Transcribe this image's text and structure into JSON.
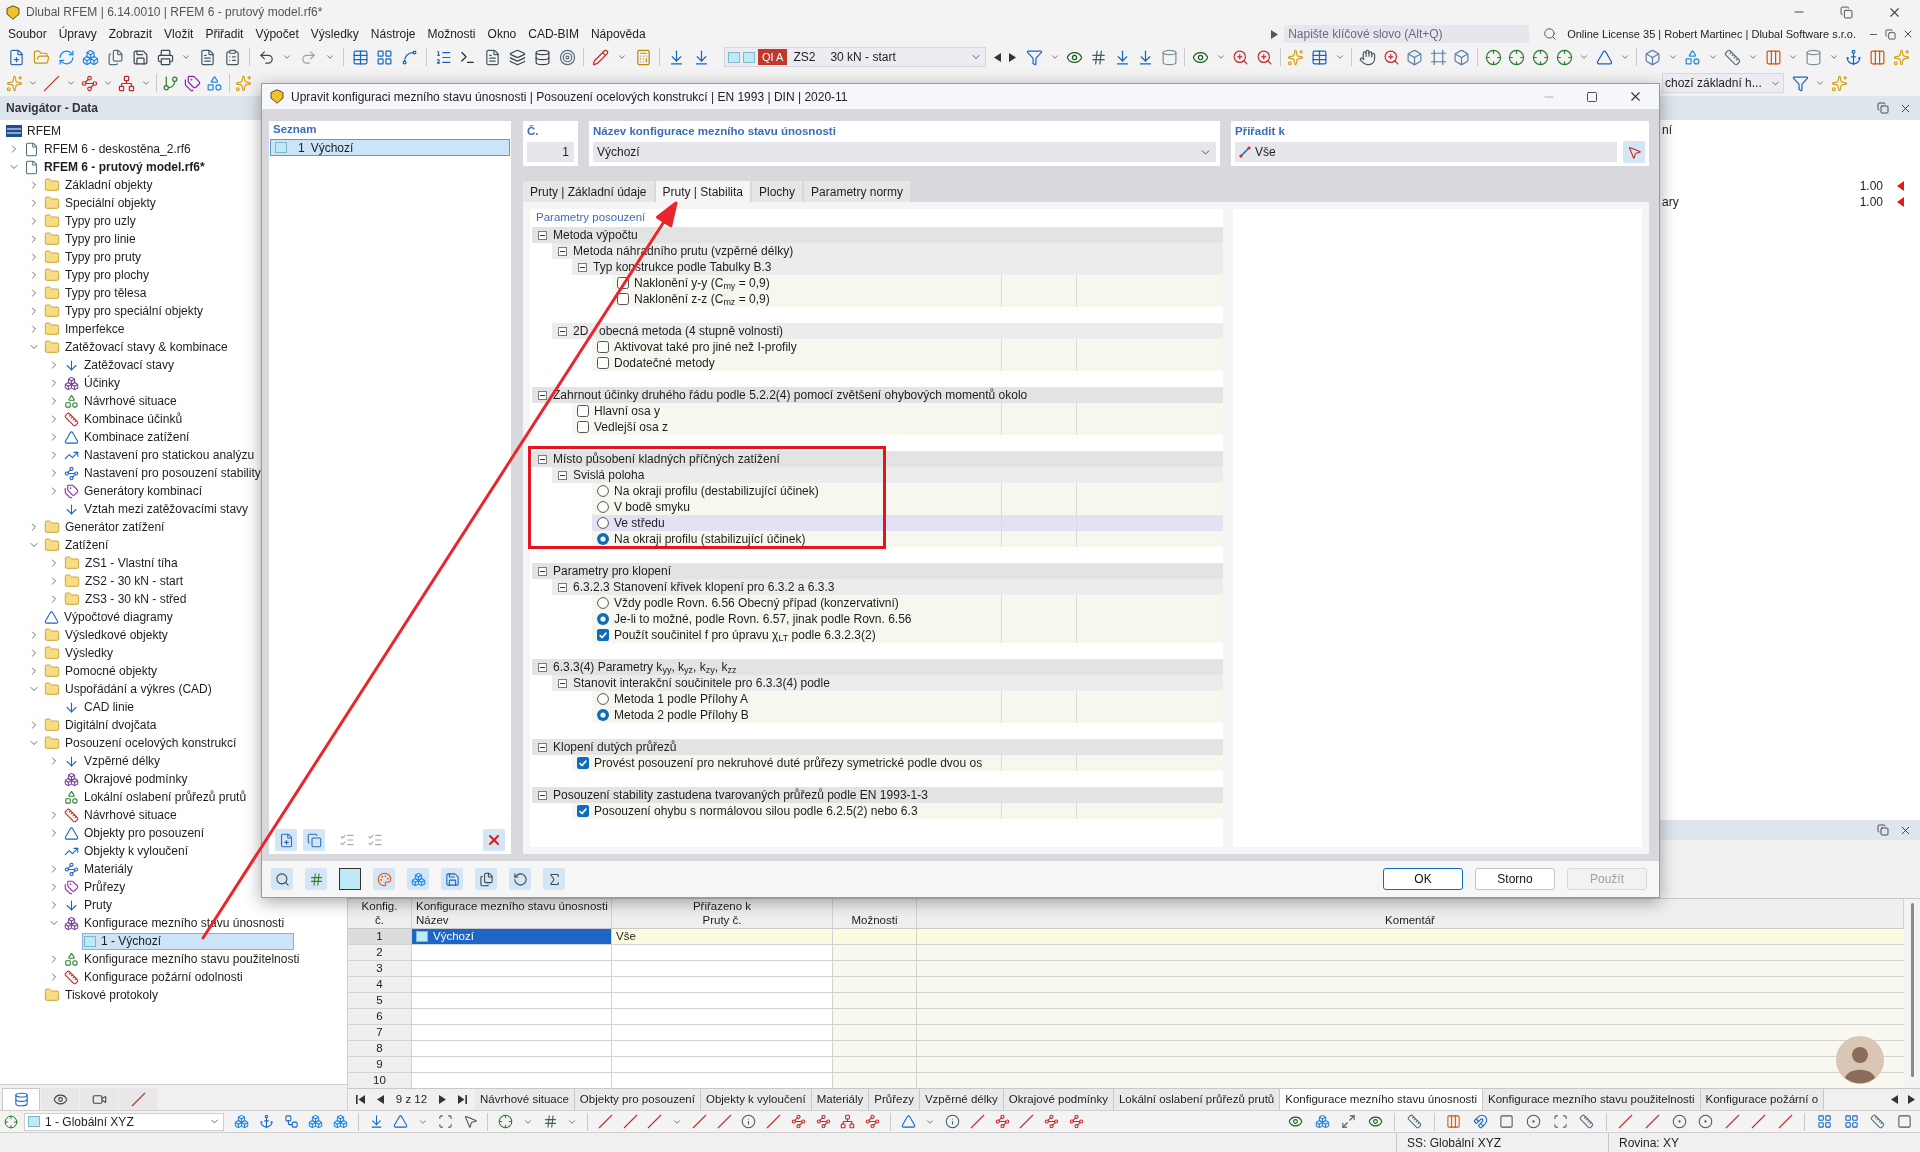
{
  "window": {
    "title": "Dlubal RFEM | 6.14.0010 | RFEM 6 - prutový model.rf6*"
  },
  "menu": [
    "Soubor",
    "Úpravy",
    "Zobrazit",
    "Vložit",
    "Přiřadit",
    "Výpočet",
    "Výsledky",
    "Nástroje",
    "Možnosti",
    "Okno",
    "CAD-BIM",
    "Nápověda"
  ],
  "search": {
    "placeholder": "Napište klíčové slovo (Alt+Q)"
  },
  "license": "Online License 35 | Robert Martinec | Dlubal Software s.r.o.",
  "toolbar": {
    "load_type": "QI A",
    "load_case": "ZS2",
    "load_case_name": "30 kN - start",
    "view_preset": "chozí základní h..."
  },
  "navigator": {
    "title": "Navigátor - Data",
    "tree": [
      {
        "label": "RFEM",
        "kind": "root",
        "selected": false,
        "children": [
          {
            "label": "RFEM 6 - deskostěna_2.rf6",
            "kind": "file",
            "active": false,
            "expanded": false,
            "selected": false
          },
          {
            "label": "RFEM 6 - prutový model.rf6*",
            "kind": "file",
            "active": true,
            "expanded": true,
            "selected": false,
            "children": [
              {
                "label": "Základní objekty",
                "kind": "folder",
                "expanded": false,
                "selected": false
              },
              {
                "label": "Speciální objekty",
                "kind": "folder",
                "expanded": false,
                "selected": false
              },
              {
                "label": "Typy pro uzly",
                "kind": "folder",
                "expanded": false,
                "selected": false
              },
              {
                "label": "Typy pro linie",
                "kind": "folder",
                "expanded": false,
                "selected": false
              },
              {
                "label": "Typy pro pruty",
                "kind": "folder",
                "expanded": false,
                "selected": false
              },
              {
                "label": "Typy pro plochy",
                "kind": "folder",
                "expanded": false,
                "selected": false
              },
              {
                "label": "Typy pro tělesa",
                "kind": "folder",
                "expanded": false,
                "selected": false
              },
              {
                "label": "Typy pro speciální objekty",
                "kind": "folder",
                "expanded": false,
                "selected": false
              },
              {
                "label": "Imperfekce",
                "kind": "folder",
                "expanded": false,
                "selected": false
              },
              {
                "label": "Zatěžovací stavy & kombinace",
                "kind": "folder",
                "expanded": true,
                "selected": false,
                "children": [
                  {
                    "label": "Zatěžovací stavy",
                    "kind": "object",
                    "expanded": false,
                    "selected": false
                  },
                  {
                    "label": "Účinky",
                    "kind": "object",
                    "expanded": false,
                    "selected": false
                  },
                  {
                    "label": "Návrhové situace",
                    "kind": "object",
                    "expanded": false,
                    "selected": false
                  },
                  {
                    "label": "Kombinace účinků",
                    "kind": "object",
                    "expanded": false,
                    "selected": false
                  },
                  {
                    "label": "Kombinace zatížení",
                    "kind": "object",
                    "expanded": false,
                    "selected": false
                  },
                  {
                    "label": "Nastavení pro statickou analýzu",
                    "kind": "object",
                    "expanded": false,
                    "selected": false
                  },
                  {
                    "label": "Nastavení pro posouzení stability",
                    "kind": "object",
                    "expanded": false,
                    "selected": false
                  },
                  {
                    "label": "Generátory kombinací",
                    "kind": "object",
                    "expanded": false,
                    "selected": false
                  },
                  {
                    "label": "Vztah mezi zatěžovacími stavy",
                    "kind": "object",
                    "selected": false
                  }
                ]
              },
              {
                "label": "Generátor zatížení",
                "kind": "folder",
                "expanded": false,
                "selected": false
              },
              {
                "label": "Zatížení",
                "kind": "folder",
                "expanded": true,
                "selected": false,
                "children": [
                  {
                    "label": "ZS1 - Vlastní tíha",
                    "kind": "folder",
                    "expanded": false,
                    "selected": false
                  },
                  {
                    "label": "ZS2 - 30 kN - start",
                    "kind": "folder",
                    "expanded": false,
                    "selected": false
                  },
                  {
                    "label": "ZS3 - 30 kN - střed",
                    "kind": "folder",
                    "expanded": false,
                    "selected": false
                  }
                ]
              },
              {
                "label": "Výpočtové diagramy",
                "kind": "object",
                "selected": false
              },
              {
                "label": "Výsledkové objekty",
                "kind": "folder",
                "expanded": false,
                "selected": false
              },
              {
                "label": "Výsledky",
                "kind": "folder",
                "expanded": false,
                "selected": false
              },
              {
                "label": "Pomocné objekty",
                "kind": "folder",
                "expanded": false,
                "selected": false
              },
              {
                "label": "Uspořádání a výkres (CAD)",
                "kind": "folder",
                "expanded": true,
                "selected": false,
                "children": [
                  {
                    "label": "CAD linie",
                    "kind": "object",
                    "selected": false
                  }
                ]
              },
              {
                "label": "Digitální dvojčata",
                "kind": "folder",
                "expanded": false,
                "selected": false
              },
              {
                "label": "Posouzení ocelových konstrukcí",
                "kind": "folder",
                "expanded": true,
                "selected": false,
                "children": [
                  {
                    "label": "Vzpěrné délky",
                    "kind": "object",
                    "expanded": false,
                    "selected": false
                  },
                  {
                    "label": "Okrajové podmínky",
                    "kind": "object",
                    "selected": false
                  },
                  {
                    "label": "Lokální oslabení průřezů prutů",
                    "kind": "object",
                    "selected": false
                  },
                  {
                    "label": "Návrhové situace",
                    "kind": "object",
                    "expanded": false,
                    "selected": false
                  },
                  {
                    "label": "Objekty pro posouzení",
                    "kind": "object",
                    "expanded": false,
                    "selected": false
                  },
                  {
                    "label": "Objekty k vyloučení",
                    "kind": "object",
                    "selected": false
                  },
                  {
                    "label": "Materiály",
                    "kind": "object",
                    "expanded": false,
                    "selected": false
                  },
                  {
                    "label": "Průřezy",
                    "kind": "object",
                    "expanded": false,
                    "selected": false
                  },
                  {
                    "label": "Pruty",
                    "kind": "object",
                    "expanded": false,
                    "selected": false
                  },
                  {
                    "label": "Konfigurace mezního stavu únosnosti",
                    "kind": "object",
                    "expanded": true,
                    "selected": false,
                    "children": [
                      {
                        "label": "1 - Výchozí",
                        "kind": "entry",
                        "selected": true
                      }
                    ]
                  },
                  {
                    "label": "Konfigurace mezního stavu použitelnosti",
                    "kind": "object",
                    "expanded": false,
                    "selected": false
                  },
                  {
                    "label": "Konfigurace požární odolnosti",
                    "kind": "object",
                    "expanded": false,
                    "selected": false
                  }
                ]
              },
              {
                "label": "Tiskové protokoly",
                "kind": "folder",
                "selected": false
              }
            ]
          }
        ]
      }
    ],
    "tabs": [
      {
        "selected": true
      },
      {
        "selected": false
      },
      {
        "selected": false
      },
      {
        "selected": false
      }
    ]
  },
  "side_panel": {
    "heading": "ní",
    "rows": [
      {
        "value": "1.00"
      },
      {
        "label": "ary",
        "value": "1.00"
      }
    ]
  },
  "dialog": {
    "title": "Upravit konfiguraci mezního stavu únosnosti | Posouzení ocelových konstrukcí | EN 1993 | DIN | 2020-11",
    "list": {
      "title": "Seznam",
      "items": [
        {
          "number": "1",
          "name": "Výchozí",
          "selected": true
        }
      ]
    },
    "number": {
      "label": "Č.",
      "value": "1"
    },
    "name": {
      "label": "Název konfigurace mezního stavu únosnosti",
      "value": "Výchozí"
    },
    "assign": {
      "label": "Přiřadit k",
      "value": "Vše"
    },
    "tabs": [
      {
        "label": "Pruty | Základní údaje",
        "selected": false
      },
      {
        "label": "Pruty | Stabilita",
        "selected": true
      },
      {
        "label": "Plochy",
        "selected": false
      },
      {
        "label": "Parametry normy",
        "selected": false
      }
    ],
    "parameters": {
      "title": "Parametry posouzení",
      "groups": [
        {
          "kind": "group",
          "label": "Metoda výpočtu",
          "expanded": true,
          "marked": false,
          "children": [
            {
              "kind": "group",
              "label": "Metoda náhradního prutu (vzpěrné délky)",
              "expanded": true,
              "children": [
                {
                  "kind": "group",
                  "label": "Typ konstrukce podle Tabulky B.3",
                  "expanded": true,
                  "children": [
                    {
                      "kind": "checkbox",
                      "label": "Naklonění y-y (C$_{my}$ = 0,9)",
                      "checked": false,
                      "focused": false
                    },
                    {
                      "kind": "checkbox",
                      "label": "Naklonění z-z (C$_{mz}$ = 0,9)",
                      "checked": false,
                      "focused": false
                    }
                  ]
                }
              ]
            },
            {
              "kind": "group",
              "label": "2D - obecná metoda (4 stupně volnosti)",
              "expanded": true,
              "children": [
                {
                  "kind": "checkbox",
                  "label": "Aktivovat také pro jiné než I-profily",
                  "checked": false,
                  "focused": false
                },
                {
                  "kind": "checkbox",
                  "label": "Dodatečné metody",
                  "checked": false,
                  "focused": false
                }
              ]
            }
          ]
        },
        {
          "kind": "group",
          "label": "Zahrnout účinky druhého řádu podle 5.2.2(4) pomocí zvětšení ohybových momentů okolo",
          "expanded": true,
          "marked": false,
          "children": [
            {
              "kind": "checkbox",
              "label": "Hlavní osa y",
              "checked": false,
              "focused": false
            },
            {
              "kind": "checkbox",
              "label": "Vedlejší osa z",
              "checked": false,
              "focused": false
            }
          ]
        },
        {
          "kind": "group",
          "label": "Místo působení kladných příčných zatížení",
          "expanded": true,
          "marked": true,
          "children": [
            {
              "kind": "group",
              "label": "Svislá poloha",
              "expanded": true,
              "children": [
                {
                  "kind": "radio",
                  "label": "Na okraji profilu (destabilizující účinek)",
                  "selected": false,
                  "focused": false
                },
                {
                  "kind": "radio",
                  "label": "V bodě smyku",
                  "selected": false,
                  "focused": false
                },
                {
                  "kind": "radio",
                  "label": "Ve středu",
                  "selected": false,
                  "focused": true
                },
                {
                  "kind": "radio",
                  "label": "Na okraji profilu (stabilizující účinek)",
                  "selected": true,
                  "focused": false
                }
              ]
            }
          ]
        },
        {
          "kind": "group",
          "label": "Parametry pro klopení",
          "expanded": true,
          "marked": false,
          "children": [
            {
              "kind": "group",
              "label": "6.3.2.3 Stanovení křivek klopení pro 6.3.2 a 6.3.3",
              "expanded": true,
              "children": [
                {
                  "kind": "radio",
                  "label": "Vždy podle Rovn. 6.56 Obecný případ (konzervativní)",
                  "selected": false,
                  "focused": false
                },
                {
                  "kind": "radio",
                  "label": "Je-li to možné, podle Rovn. 6.57, jinak podle Rovn. 6.56",
                  "selected": true,
                  "focused": false
                },
                {
                  "kind": "checkbox",
                  "label": "Použít součinitel f pro úpravu χ$_{LT}$ podle 6.3.2.3(2)",
                  "checked": true,
                  "focused": false
                }
              ]
            }
          ]
        },
        {
          "kind": "group",
          "label": "6.3.3(4) Parametry k$_{yy}$, k$_{yz}$, k$_{zy}$, k$_{zz}$",
          "expanded": true,
          "marked": false,
          "children": [
            {
              "kind": "group",
              "label": "Stanovit interakční součinitele pro 6.3.3(4) podle",
              "expanded": true,
              "children": [
                {
                  "kind": "radio",
                  "label": "Metoda 1 podle Přílohy A",
                  "selected": false,
                  "focused": false
                },
                {
                  "kind": "radio",
                  "label": "Metoda 2 podle Přílohy B",
                  "selected": true,
                  "focused": false
                }
              ]
            }
          ]
        },
        {
          "kind": "group",
          "label": "Klopení dutých průřezů",
          "expanded": true,
          "marked": false,
          "children": [
            {
              "kind": "checkbox",
              "label": "Provést posouzení pro nekruhové duté průřezy symetrické podle dvou os",
              "checked": true,
              "focused": false
            }
          ]
        },
        {
          "kind": "group",
          "label": "Posouzení stability zastudena tvarovaných průřezů podle EN 1993-1-3",
          "expanded": true,
          "marked": false,
          "children": [
            {
              "kind": "checkbox",
              "label": "Posouzení ohybu s normálovou silou podle 6.2.5(2) nebo 6.3",
              "checked": true,
              "focused": false
            }
          ]
        }
      ]
    },
    "buttons": [
      {
        "label": "OK",
        "kind": "default",
        "disabled": false
      },
      {
        "label": "Storno",
        "kind": "normal",
        "disabled": false
      },
      {
        "label": "Použít",
        "kind": "normal",
        "disabled": true
      }
    ]
  },
  "table": {
    "columns": [
      {
        "heading": "Konfig.",
        "subheading": "č."
      },
      {
        "heading": "Konfigurace mezního stavu únosnosti",
        "subheading": "Název"
      },
      {
        "heading": "Přiřazeno k",
        "subheading": "Pruty č."
      },
      {
        "subheading": "Možnosti"
      },
      {
        "subheading": "Komentář"
      }
    ],
    "rows": [
      {
        "number": "1",
        "name": "Výchozí",
        "members": "Vše",
        "selected": true
      },
      {
        "number": "2",
        "selected": false
      },
      {
        "number": "3",
        "selected": false
      },
      {
        "number": "4",
        "selected": false
      },
      {
        "number": "5",
        "selected": false
      },
      {
        "number": "6",
        "selected": false
      },
      {
        "number": "7",
        "selected": false
      },
      {
        "number": "8",
        "selected": false
      },
      {
        "number": "9",
        "selected": false
      },
      {
        "number": "10",
        "selected": false
      }
    ]
  },
  "sheet_tabs": {
    "pager": "9 z 12",
    "tabs": [
      {
        "label": "Návrhové situace",
        "selected": false
      },
      {
        "label": "Objekty pro posouzení",
        "selected": false
      },
      {
        "label": "Objekty k vyloučení",
        "selected": false
      },
      {
        "label": "Materiály",
        "selected": false
      },
      {
        "label": "Průřezy",
        "selected": false
      },
      {
        "label": "Vzpěrné délky",
        "selected": false
      },
      {
        "label": "Okrajové podmínky",
        "selected": false
      },
      {
        "label": "Lokální oslabení průřezů prutů",
        "selected": false
      },
      {
        "label": "Konfigurace mezního stavu únosnosti",
        "selected": true
      },
      {
        "label": "Konfigurace mezního stavu použitelnosti",
        "selected": false
      },
      {
        "label": "Konfigurace požární o",
        "selected": false
      }
    ]
  },
  "bottom_toolbar": {
    "coordinate_system": "1 - Globální XYZ"
  },
  "status_bar": {
    "fields": [
      "SS: Globální XYZ",
      "Rovina: XY"
    ]
  }
}
